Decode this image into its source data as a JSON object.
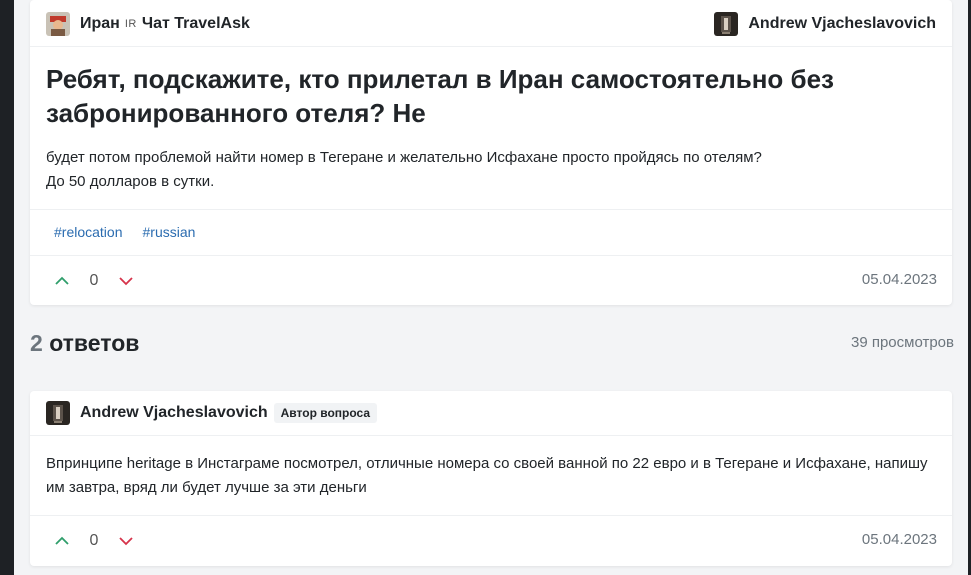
{
  "question": {
    "chat_name": "Иран",
    "country_code": "IR",
    "chat_suffix": "Чат TravelAsk",
    "author": "Andrew Vjacheslavovich",
    "title": "Ребят, подскажите, кто прилетал в Иран самостоятельно без забронированного отеля? Не",
    "body_line1": "будет потом проблемой найти номер в Тегеране и желательно Исфахане просто пройдясь по отелям?",
    "body_line2": "До 50 долларов в сутки.",
    "tags": [
      "#relocation",
      "#russian"
    ],
    "votes": "0",
    "date": "05.04.2023"
  },
  "answers_section": {
    "count": "2",
    "label": "ответов",
    "views": "39 просмотров"
  },
  "answer": {
    "author": "Andrew Vjacheslavovich",
    "badge": "Автор вопроса",
    "body": "Впринципе heritage в Инстаграме посмотрел, отличные номера со своей ванной по 22 евро и в Тегеране и Исфахане, напишу им завтра, вряд ли будет лучше за эти деньги",
    "votes": "0",
    "date": "05.04.2023"
  },
  "colors": {
    "upvote": "#2f9e6b",
    "downvote": "#d6334a",
    "tag_link": "#2b6cb0"
  }
}
